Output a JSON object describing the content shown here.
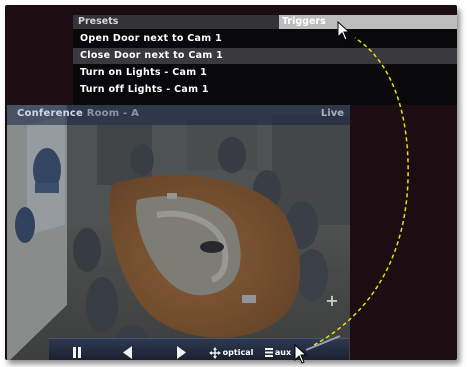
{
  "menu": {
    "tabs": {
      "presets": "Presets",
      "triggers": "Triggers"
    },
    "items": [
      {
        "label": "Open Door next to Cam 1",
        "selected": false
      },
      {
        "label": "Close Door next to Cam 1",
        "selected": true
      },
      {
        "label": "Turn on Lights - Cam 1",
        "selected": false
      },
      {
        "label": "Turn off Lights - Cam 1",
        "selected": false
      }
    ]
  },
  "camera": {
    "name": "Conference",
    "name_rest": " Room - A",
    "status": "Live"
  },
  "toolbar": {
    "optical_label": "optical",
    "aux_label": "aux"
  },
  "icons": {
    "pause": "pause-icon",
    "prev": "triangle-left-icon",
    "next": "triangle-right-icon",
    "optical": "move-arrows-icon",
    "aux": "aux-list-icon",
    "cursor": "mouse-pointer-icon",
    "zoom": "plus-icon"
  },
  "colors": {
    "frame_bg": "#1b0d12",
    "tab_active": "#bdbdbd",
    "highlight_row": "#3a3a3e",
    "dash_line": "#e8e010"
  }
}
